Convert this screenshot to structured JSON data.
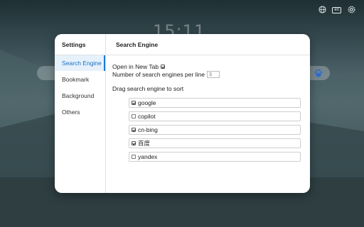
{
  "background": {
    "clock": "15:11",
    "topbar": {
      "lang_badge": "en",
      "icons": [
        "globe-icon",
        "settings-gear-icon"
      ]
    }
  },
  "modal": {
    "sidebar": {
      "title": "Settings",
      "items": [
        {
          "label": "Search Engine",
          "active": true
        },
        {
          "label": "Bookmark",
          "active": false
        },
        {
          "label": "Background",
          "active": false
        },
        {
          "label": "Others",
          "active": false
        }
      ]
    },
    "main": {
      "title": "Search Engine",
      "open_new_tab": {
        "label": "Open in New Tab",
        "checked": true
      },
      "per_line": {
        "label": "Number of search engines per line",
        "placeholder": "3"
      },
      "drag_hint": "Drag search engine to sort",
      "engines": [
        {
          "label": "google",
          "checked": true
        },
        {
          "label": "copilot",
          "checked": false
        },
        {
          "label": "cn-bing",
          "checked": true
        },
        {
          "label": "百度",
          "checked": true
        },
        {
          "label": "yandex",
          "checked": false
        }
      ]
    }
  },
  "colors": {
    "accent": "#1a7ad8",
    "active_bg": "#e6f1fb"
  }
}
